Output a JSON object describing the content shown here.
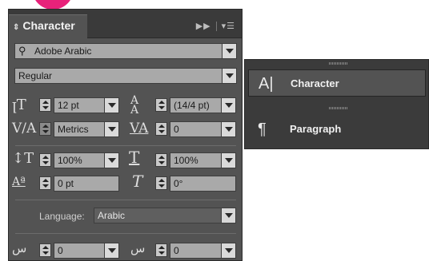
{
  "panel": {
    "tab_title": "Character",
    "header_icons": [
      "expand-icon",
      "panel-menu-icon"
    ],
    "font_family": "Adobe Arabic",
    "font_style": "Regular",
    "font_size": "12 pt",
    "leading": "(14/4 pt)",
    "kerning": "Metrics",
    "tracking": "0",
    "vertical_scale": "100%",
    "horizontal_scale": "100%",
    "baseline_shift": "0 pt",
    "skew": "0°",
    "language_label": "Language:",
    "language": "Arabic",
    "bottom_left_value": "0",
    "bottom_right_value": "0"
  },
  "side_panel": {
    "items": [
      {
        "label": "Character",
        "icon": "character-icon"
      },
      {
        "label": "Paragraph",
        "icon": "paragraph-icon"
      }
    ]
  }
}
